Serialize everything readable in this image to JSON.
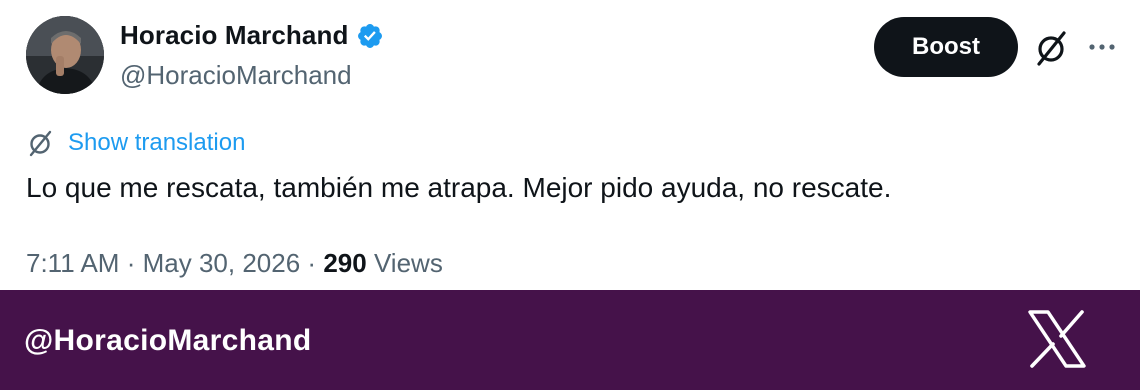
{
  "author": {
    "display_name": "Horacio Marchand",
    "handle": "@HoracioMarchand",
    "verified": true,
    "verified_color": "#1d9bf0"
  },
  "actions": {
    "boost_label": "Boost"
  },
  "tweet": {
    "translate_label": "Show translation",
    "text": "Lo que me rescata, también me atrapa. Mejor pido ayuda, no rescate.",
    "time": "7:11 AM",
    "date": "May 30, 2026",
    "separator": "·",
    "views_count": "290",
    "views_label": "Views"
  },
  "footer": {
    "handle": "@HoracioMarchand",
    "background": "#45124a",
    "logo_icon": "x-logo-icon"
  },
  "icons": {
    "verified": "verified-badge-icon",
    "grok": "grok-icon",
    "more": "more-options-icon",
    "translate": "translate-icon"
  }
}
